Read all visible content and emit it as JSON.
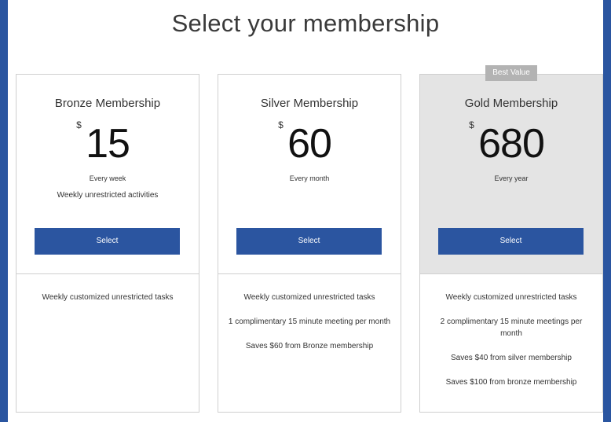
{
  "page": {
    "title": "Select your membership"
  },
  "colors": {
    "frame": "#2a55a0",
    "button": "#2b55a0",
    "highlight": "#e4e4e4",
    "badge": "#b3b3b3"
  },
  "plans": [
    {
      "name": "Bronze Membership",
      "currency": "$",
      "amount": "15",
      "period": "Every week",
      "tagline": "Weekly unrestricted activities",
      "button_label": "Select",
      "features": [
        "Weekly customized unrestricted tasks"
      ]
    },
    {
      "name": "Silver Membership",
      "currency": "$",
      "amount": "60",
      "period": "Every month",
      "tagline": "",
      "button_label": "Select",
      "features": [
        "Weekly customized unrestricted tasks",
        "1 complimentary 15 minute meeting per month",
        "Saves $60 from Bronze membership"
      ]
    },
    {
      "name": "Gold Membership",
      "badge": "Best Value",
      "currency": "$",
      "amount": "680",
      "period": "Every year",
      "tagline": "",
      "button_label": "Select",
      "features": [
        "Weekly customized unrestricted tasks",
        "2 complimentary 15 minute meetings per month",
        "Saves $40 from silver membership",
        "Saves $100 from bronze membership"
      ]
    }
  ]
}
